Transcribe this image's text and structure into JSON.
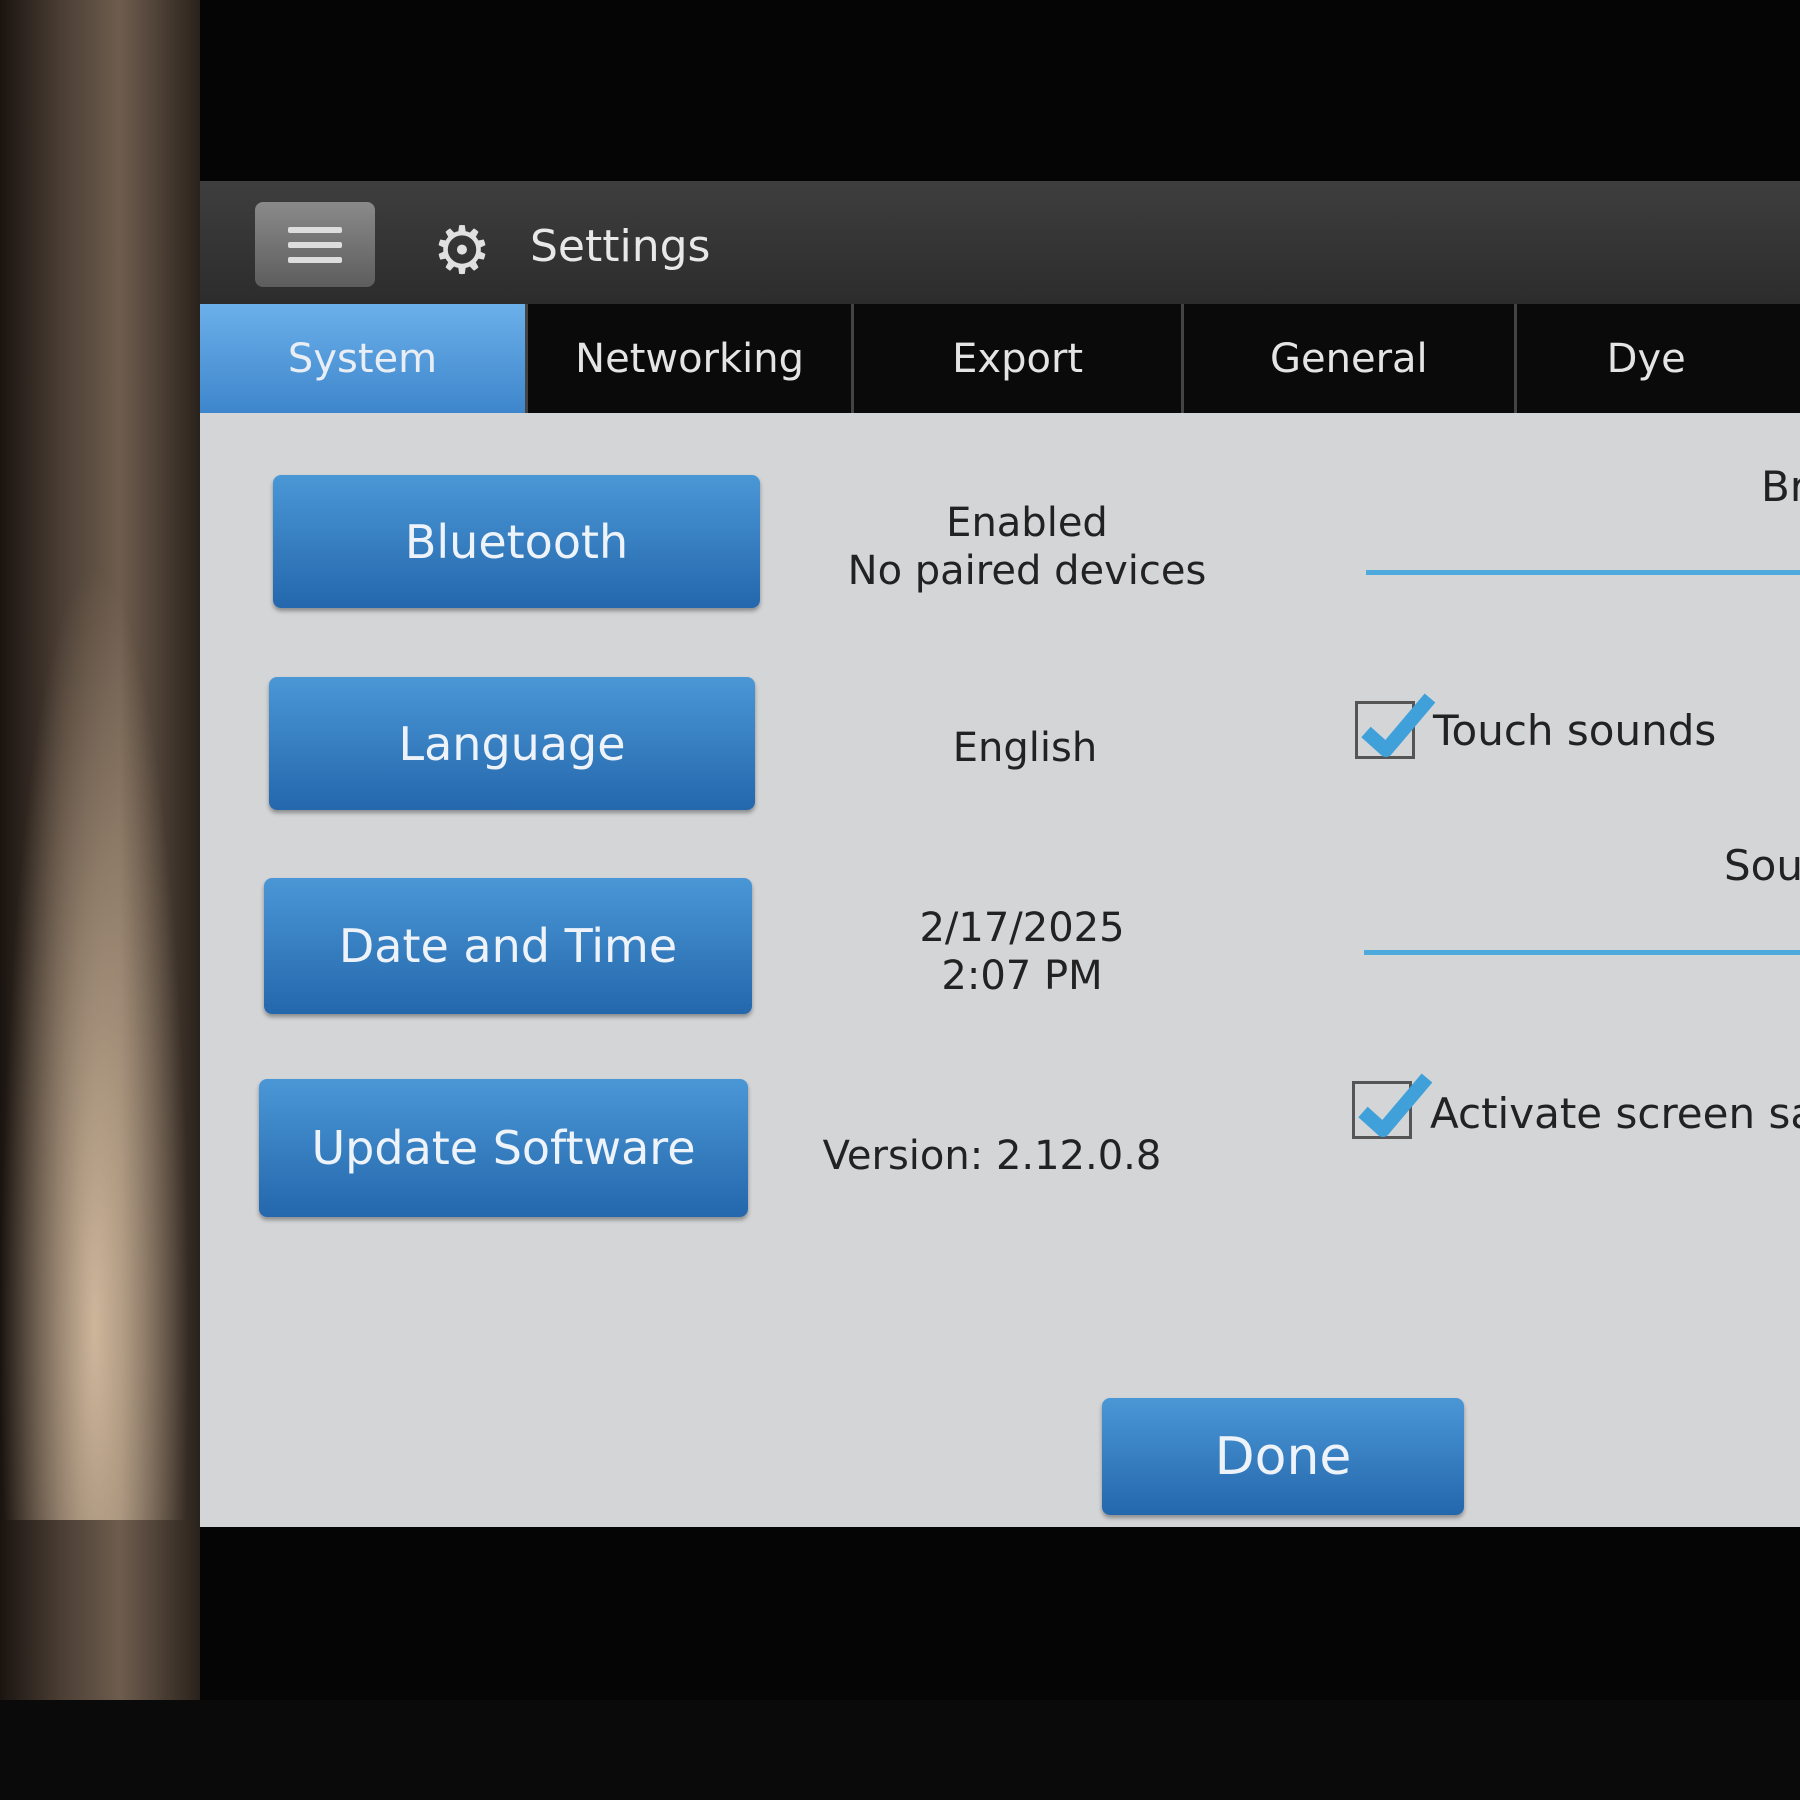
{
  "header": {
    "title": "Settings",
    "menu_icon": "hamburger-icon",
    "settings_icon": "gear-icon"
  },
  "tabs": [
    {
      "label": "System",
      "active": true
    },
    {
      "label": "Networking"
    },
    {
      "label": "Export"
    },
    {
      "label": "General"
    },
    {
      "label": "Dye"
    }
  ],
  "rows": [
    {
      "button": "Bluetooth",
      "value_line1": "Enabled",
      "value_line2": "No paired devices"
    },
    {
      "button": "Language",
      "value_line1": "English"
    },
    {
      "button": "Date and Time",
      "value_line1": "2/17/2025",
      "value_line2": "2:07 PM"
    },
    {
      "button": "Update Software",
      "value_line1": "Version: 2.12.0.8"
    }
  ],
  "right": {
    "brightness_label": "Br",
    "touch_sounds": {
      "label": "Touch sounds",
      "checked": true
    },
    "sound_label": "Sou",
    "screensaver": {
      "label": "Activate screen sav",
      "checked": true
    }
  },
  "done_label": "Done",
  "colors": {
    "accent": "#3a82c8",
    "content_bg": "#d4d5d7",
    "slider": "#4ea9dc"
  }
}
